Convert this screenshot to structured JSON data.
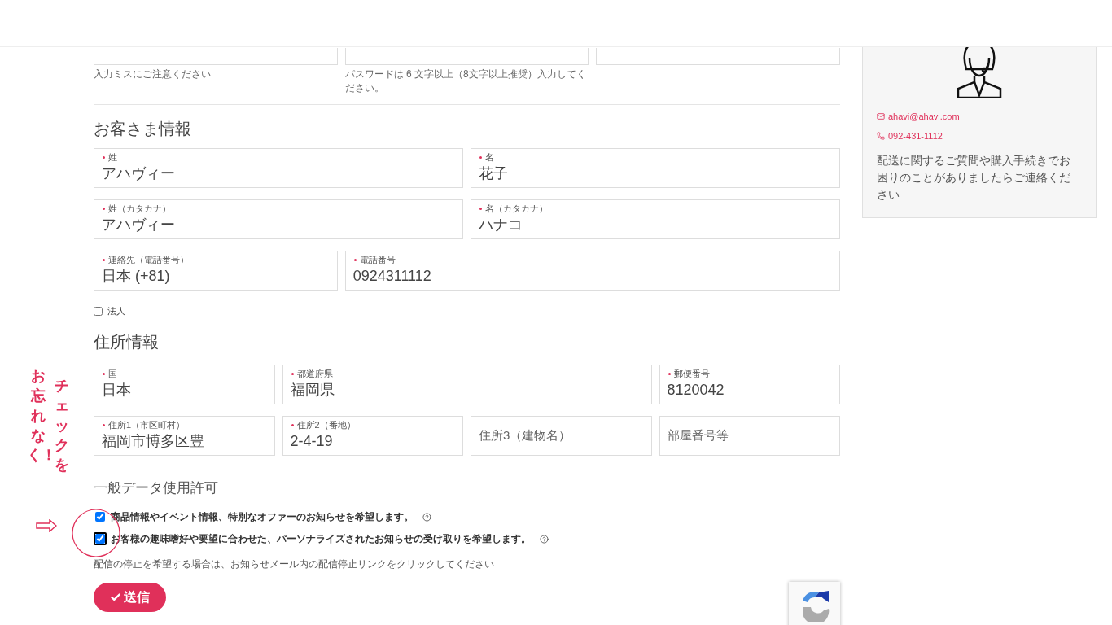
{
  "account_fields": [
    {
      "kind": "field",
      "hint": "入力ミスにご注意ください"
    },
    {
      "kind": "field",
      "hint": "パスワードは 6 文字以上（8文字以上推奨）入力してください。"
    },
    {
      "kind": "field"
    }
  ],
  "customer": {
    "heading": "お客さま情報",
    "fields": [
      {
        "label": "姓",
        "required": true,
        "value": "アハヴィー"
      },
      {
        "label": "名",
        "required": true,
        "value": "花子"
      },
      {
        "label": "姓（カタカナ）",
        "required": true,
        "value": "アハヴィー"
      },
      {
        "label": "名（カタカナ）",
        "required": true,
        "value": "ハナコ"
      },
      {
        "label": "連絡先（電話番号）",
        "required": true,
        "value": "日本 (+81)"
      },
      {
        "label": "電話番号",
        "required": true,
        "value": "0924311112"
      }
    ],
    "corporate": {
      "label": "法人",
      "checked": false
    }
  },
  "address": {
    "heading": "住所情報",
    "fields": [
      {
        "label": "国",
        "required": true,
        "value": "日本"
      },
      {
        "label": "都道府県",
        "required": true,
        "value": "福岡県"
      },
      {
        "label": "郵便番号",
        "required": true,
        "value": "8120042"
      },
      {
        "label": "住所1（市区町村）",
        "required": true,
        "value": "福岡市博多区豊"
      },
      {
        "label": "住所2（番地）",
        "required": true,
        "value": "2-4-19"
      },
      {
        "placeholder": "住所3（建物名）"
      },
      {
        "placeholder": "部屋番号等"
      }
    ]
  },
  "consent": {
    "heading": "一般データ使用許可",
    "options": [
      {
        "label": "商品情報やイベント情報、特別なオファーのお知らせを希望します。",
        "checked": true,
        "focused": false
      },
      {
        "label": "お客様の趣味嗜好や要望に合わせた、パーソナライズされたお知らせの受け取りを希望します。",
        "checked": true,
        "focused": true
      }
    ],
    "note": "配信の停止を希望する場合は、お知らせメール内の配信停止リンクをクリックしてください"
  },
  "submit": {
    "label": "送信"
  },
  "sidebar": {
    "email": "ahavi@ahavi.com",
    "phone": "092-431-1112",
    "message": "配送に関するご質問や購入手続きでお困りのことがありましたらご連絡ください"
  },
  "annotation": {
    "columns": [
      "チェックを",
      "お忘れなく！"
    ]
  }
}
